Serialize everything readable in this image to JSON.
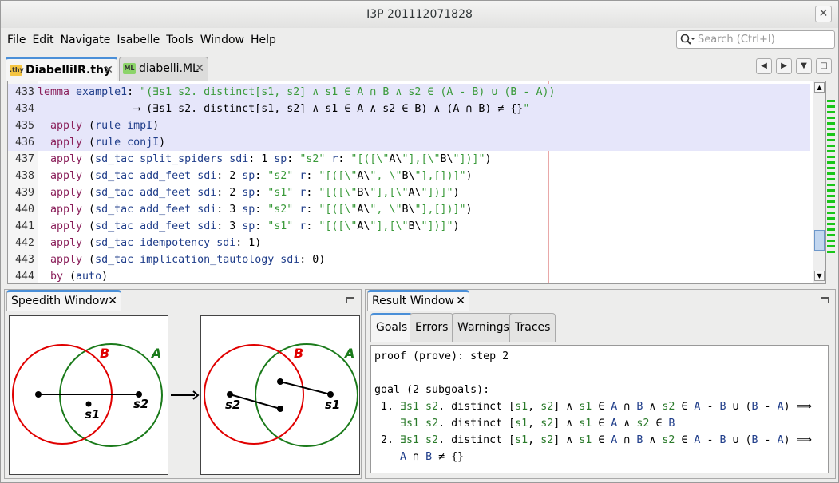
{
  "window": {
    "title": "I3P 201112071828"
  },
  "menu": [
    "File",
    "Edit",
    "Navigate",
    "Isabelle",
    "Tools",
    "Window",
    "Help"
  ],
  "search": {
    "placeholder": "Search (Ctrl+I)"
  },
  "tabs": [
    {
      "label": "DiabelliIR.thy",
      "icon": ".thy",
      "active": true
    },
    {
      "label": "diabelli.ML",
      "icon": "ML",
      "active": false
    }
  ],
  "editor": {
    "lines": [
      {
        "num": "433",
        "text": "lemma example1: \"(∃s1 s2. distinct[s1, s2] ∧ s1 ∈ A ∩ B ∧ s2 ∈ (A - B) ∪ (B - A))"
      },
      {
        "num": "434",
        "text": "               ⟶ (∃s1 s2. distinct[s1, s2] ∧ s1 ∈ A ∧ s2 ∈ B) ∧ (A ∩ B) ≠ {}\""
      },
      {
        "num": "435",
        "text": "  apply (rule impI)"
      },
      {
        "num": "436",
        "text": "  apply (rule conjI)"
      },
      {
        "num": "437",
        "text": "  apply (sd_tac split_spiders sdi: 1 sp: \"s2\" r: \"[([\\\"A\\\"],[\\\"B\\\"])]\")"
      },
      {
        "num": "438",
        "text": "  apply (sd_tac add_feet sdi: 2 sp: \"s2\" r: \"[([\\\"A\\\", \\\"B\\\"],[])]\")"
      },
      {
        "num": "439",
        "text": "  apply (sd_tac add_feet sdi: 2 sp: \"s1\" r: \"[([\\\"B\\\"],[\\\"A\\\"])]\")"
      },
      {
        "num": "440",
        "text": "  apply (sd_tac add_feet sdi: 3 sp: \"s2\" r: \"[([\\\"A\\\", \\\"B\\\"],[])]\")"
      },
      {
        "num": "441",
        "text": "  apply (sd_tac add_feet sdi: 3 sp: \"s1\" r: \"[([\\\"A\\\"],[\\\"B\\\"])]\")"
      },
      {
        "num": "442",
        "text": "  apply (sd_tac idempotency sdi: 1)"
      },
      {
        "num": "443",
        "text": "  apply (sd_tac implication_tautology sdi: 0)"
      },
      {
        "num": "444",
        "text": "  by (auto)"
      }
    ]
  },
  "speedith": {
    "title": "Speedith Window",
    "labels": {
      "A": "A",
      "B": "B",
      "s1": "s1",
      "s2": "s2"
    }
  },
  "result": {
    "title": "Result Window",
    "tabs": [
      "Goals",
      "Errors",
      "Warnings",
      "Traces"
    ],
    "output": {
      "l1": "proof (prove): step 2",
      "l2": "goal (2 subgoals):"
    }
  },
  "colors": {
    "red": "#e00000",
    "green": "#1a7a1a",
    "accent": "#4a8fd8"
  }
}
